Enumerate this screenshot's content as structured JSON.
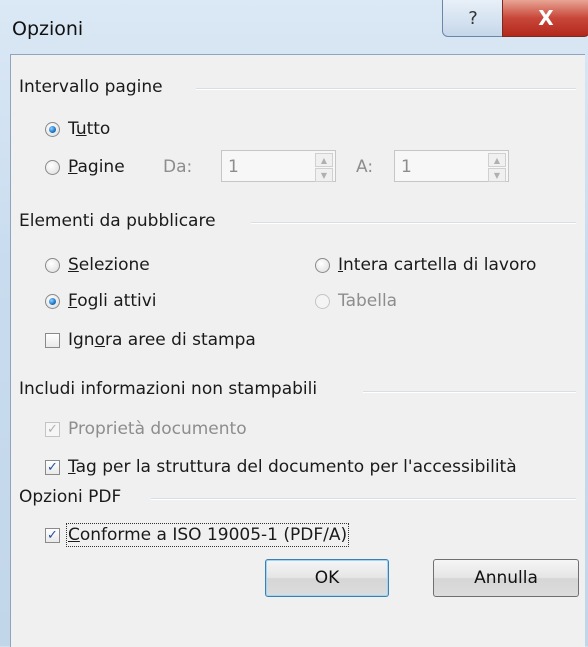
{
  "window": {
    "title": "Opzioni",
    "help_glyph": "?",
    "close_glyph": "X"
  },
  "page_range": {
    "label": "Intervallo pagine",
    "all": {
      "label_prefix": "T",
      "label_u": "u",
      "label_rest": "tto",
      "selected": true
    },
    "pages": {
      "label_u": "P",
      "label_rest": "agine",
      "selected": false
    },
    "from_label": "Da:",
    "from_value": "1",
    "to_label": "A:",
    "to_value": "1"
  },
  "publish": {
    "label": "Elementi da pubblicare",
    "selection": {
      "label_u": "S",
      "label_rest": "elezione",
      "selected": false
    },
    "whole_workbook": {
      "label_u": "I",
      "label_rest": "ntera cartella di lavoro",
      "selected": false
    },
    "active_sheets": {
      "label_u": "F",
      "label_rest": "ogli attivi",
      "selected": true
    },
    "table": {
      "label": "Tabella",
      "selected": false,
      "enabled": false
    },
    "ignore_print_areas": {
      "label_prefix": "Ign",
      "label_u": "o",
      "label_rest": "ra aree di stampa",
      "checked": false
    }
  },
  "nonprint": {
    "label": "Includi informazioni non stampabili",
    "doc_props": {
      "label": "Proprietà documento",
      "checked": true,
      "enabled": false
    },
    "struct_tags": {
      "label_u": "T",
      "label_rest": "ag per la struttura del documento per l'accessibilità",
      "checked": true
    }
  },
  "pdf": {
    "label": "Opzioni PDF",
    "iso": {
      "label_u": "C",
      "label_rest": "onforme a ISO 19005-1 (PDF/A)",
      "checked": true
    }
  },
  "buttons": {
    "ok": "OK",
    "cancel": "Annulla"
  },
  "glyphs": {
    "check": "✓",
    "up": "▲",
    "down": "▼"
  }
}
